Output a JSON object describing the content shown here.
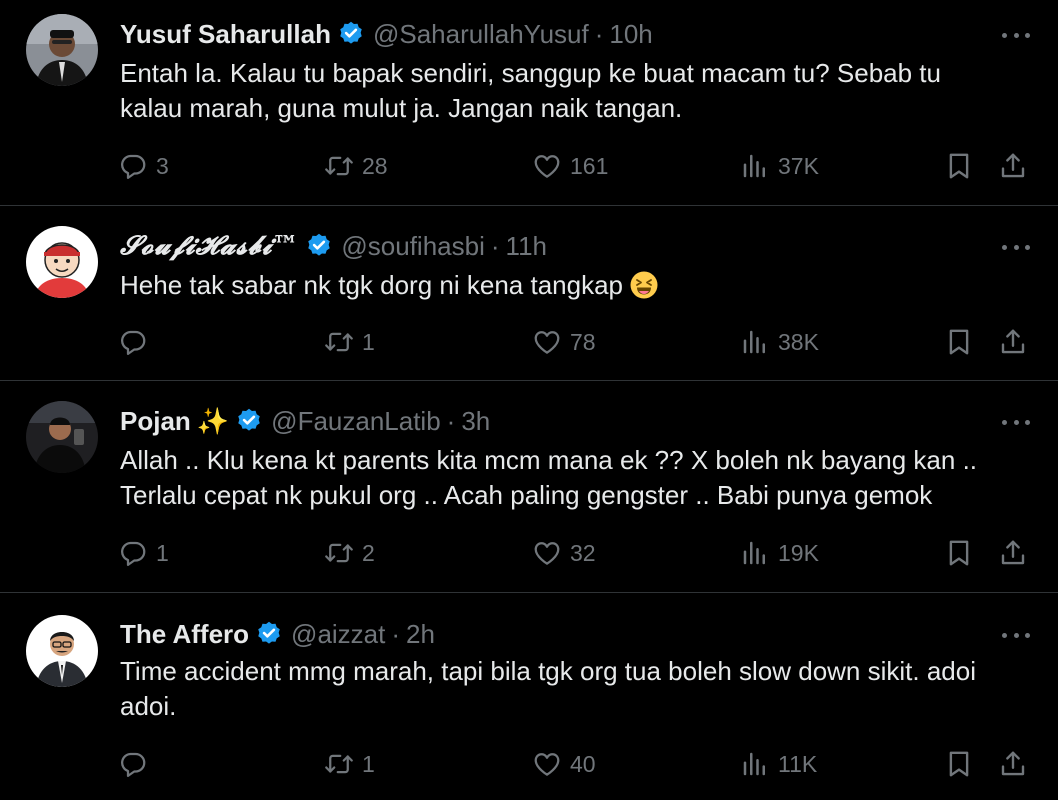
{
  "tweets": [
    {
      "name": "Yusuf Saharullah",
      "handle": "@SaharullahYusuf",
      "separator": "·",
      "time": "10h",
      "text": "Entah la. Kalau tu bapak sendiri, sanggup ke buat macam tu? Sebab tu\nkalau marah, guna mulut ja. Jangan naik tangan.",
      "replies": "3",
      "retweets": "28",
      "likes": "161",
      "views": "37K"
    },
    {
      "name": "𝓢𝓸𝓾𝓯𝓲𝓗𝓪𝓼𝓫𝓲™",
      "handle": "@soufihasbi",
      "separator": "·",
      "time": "11h",
      "text": "Hehe tak sabar nk tgk dorg ni kena tangkap",
      "replies": "",
      "retweets": "1",
      "likes": "78",
      "views": "38K"
    },
    {
      "name": "Pojan",
      "name_emoji": "✨",
      "handle": "@FauzanLatib",
      "separator": "·",
      "time": "3h",
      "text": "Allah .. Klu kena kt parents kita mcm mana ek ?? X boleh nk bayang kan ..\nTerlalu cepat nk pukul org .. Acah paling gengster .. Babi punya gemok",
      "replies": "1",
      "retweets": "2",
      "likes": "32",
      "views": "19K"
    },
    {
      "name": "The Affero",
      "handle": "@aizzat",
      "separator": "·",
      "time": "2h",
      "text": "Time accident mmg marah, tapi bila tgk org tua boleh slow down sikit. adoi\nadoi.",
      "replies": "",
      "retweets": "1",
      "likes": "40",
      "views": "11K"
    }
  ],
  "colors": {
    "background": "#000000",
    "primary_text": "#e7e9ea",
    "secondary_text": "#71767b",
    "verified_badge": "#1d9bf0",
    "divider": "#2f3336"
  },
  "icons": {
    "reply": "reply-icon",
    "retweet": "retweet-icon",
    "like": "heart-icon",
    "views": "views-icon",
    "bookmark": "bookmark-icon",
    "share": "share-icon",
    "more": "more-icon",
    "verified": "verified-badge-icon"
  }
}
